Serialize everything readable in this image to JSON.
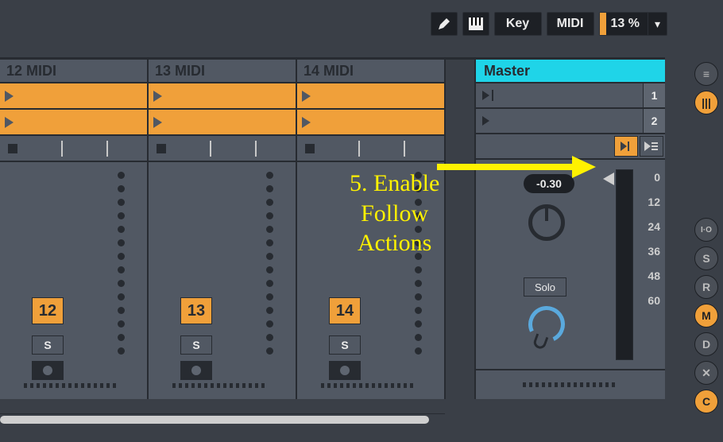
{
  "topbar": {
    "key_label": "Key",
    "midi_label": "MIDI",
    "percent": "13 %"
  },
  "tracks": [
    {
      "name": "12 MIDI",
      "num": "12",
      "solo": "S"
    },
    {
      "name": "13 MIDI",
      "num": "13",
      "solo": "S"
    },
    {
      "name": "14 MIDI",
      "num": "14",
      "solo": "S"
    }
  ],
  "master": {
    "title": "Master",
    "scenes": [
      "1",
      "2"
    ],
    "tempo": "-0.30",
    "solo_label": "Solo",
    "db_scale": [
      "0",
      "12",
      "24",
      "36",
      "48",
      "60"
    ]
  },
  "sidebar": {
    "buttons": [
      "≡",
      "|||",
      "I·O",
      "S",
      "R",
      "M",
      "D",
      "✕",
      "C"
    ]
  },
  "annotation": {
    "text": "5. Enable Follow Actions"
  }
}
